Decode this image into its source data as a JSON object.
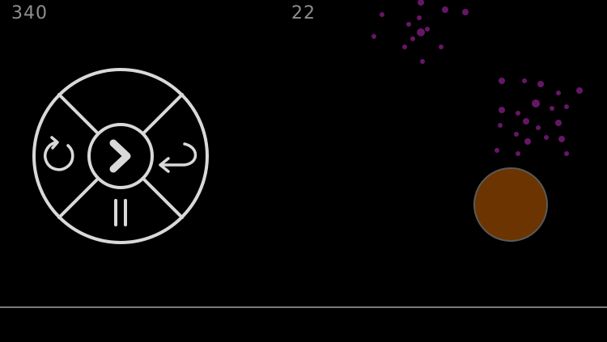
{
  "hud": {
    "score": "340",
    "counter": "22"
  },
  "menu": {
    "play_icon": "play-chevron-icon",
    "restart_icon": "restart-icon",
    "back_icon": "back-return-icon",
    "pause_icon": "pause-icon"
  },
  "colors": {
    "background": "#000000",
    "hud_text": "#8e8e8e",
    "menu_stroke": "#d9d9d9",
    "ball": "#6b3401",
    "particles": "#7a1a7a",
    "ground": "#7a7a7a"
  }
}
